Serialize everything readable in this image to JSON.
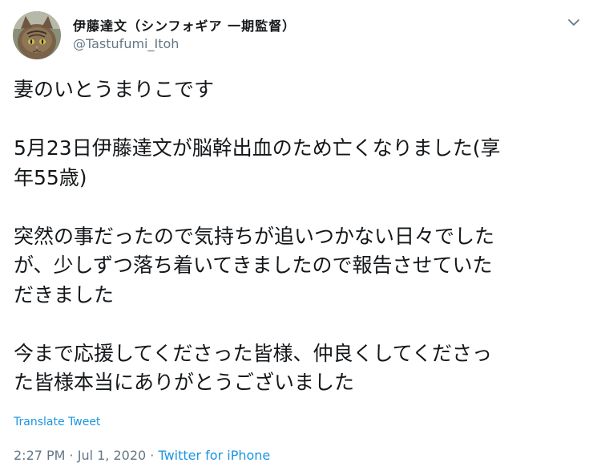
{
  "user": {
    "display_name": "伊藤達文（シンフォギア 一期監督）",
    "handle": "@Tastufumi_Itoh",
    "avatar_icon": "cat-avatar-icon"
  },
  "menu_icon": "chevron-down-icon",
  "tweet": {
    "lines": [
      "妻のいとうまりこです",
      "",
      "5月23日伊藤達文が脳幹出血のため亡くなりました(享",
      "年55歳)",
      "",
      "突然の事だったので気持ちが追いつかない日々でした",
      "が、少しずつ落ち着いてきましたので報告させていた",
      "だきました",
      "",
      "今まで応援してくださった皆様、仲良くしてくださっ",
      "た皆様本当にありがとうございました"
    ],
    "translate_label": "Translate Tweet",
    "timestamp": "2:27 PM · Jul 1, 2020",
    "separator": " · ",
    "source": "Twitter for iPhone"
  },
  "colors": {
    "text": "#14171a",
    "secondary": "#657786",
    "link": "#1b95e0"
  }
}
